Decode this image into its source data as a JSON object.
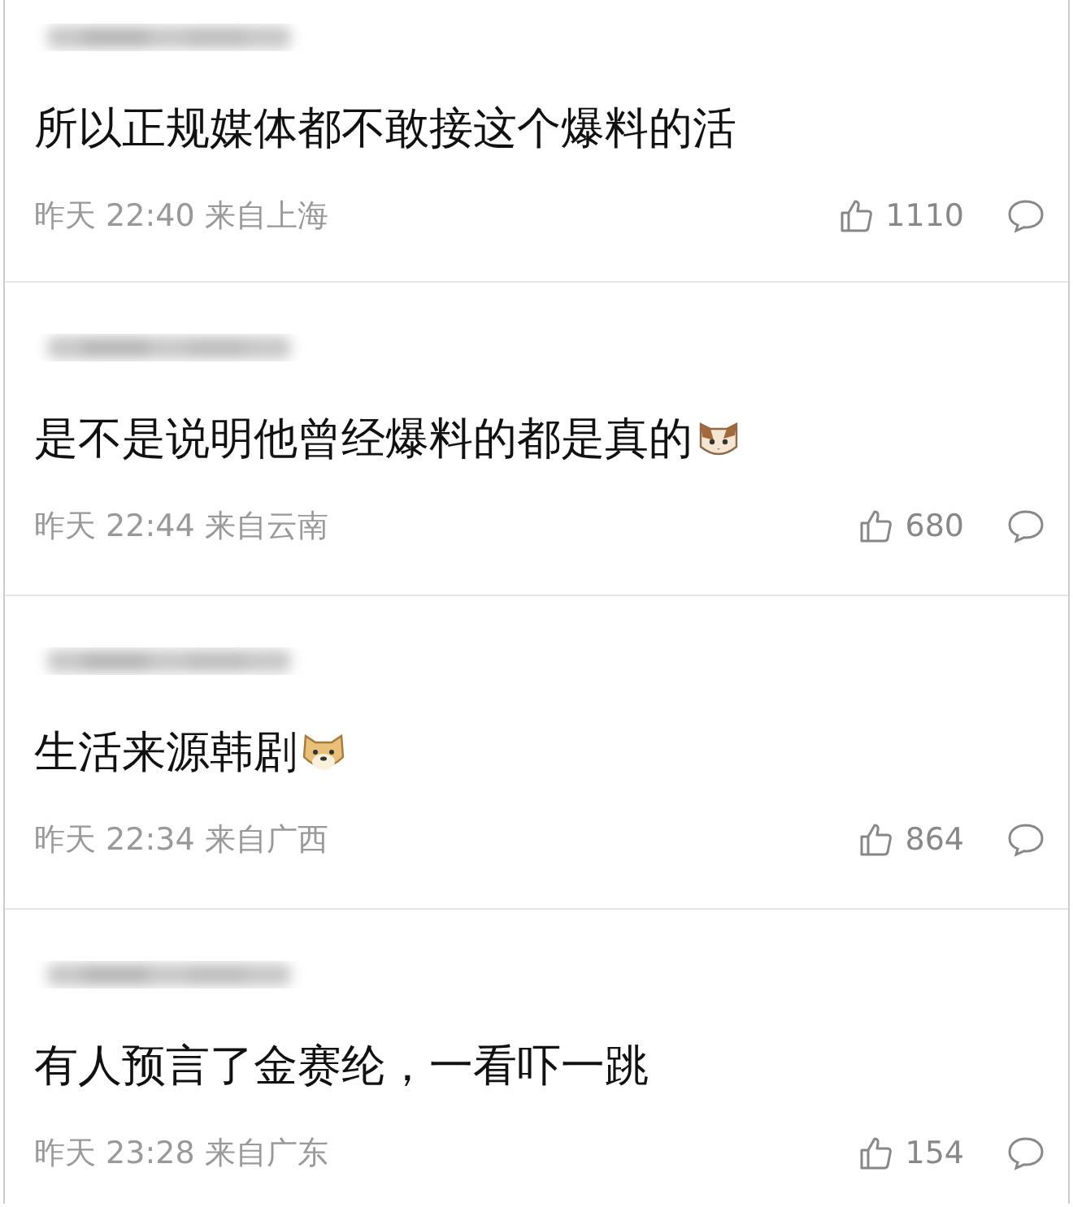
{
  "comments": [
    {
      "kind": "plain",
      "text": "所以正规媒体都不敢接这个爆料的活",
      "meta": "昨天 22:40 来自上海",
      "likes": "1110"
    },
    {
      "kind": "cat",
      "text": "是不是说明他曾经爆料的都是真的",
      "meta": "昨天 22:44 来自云南",
      "likes": "680"
    },
    {
      "kind": "doge",
      "text": "生活来源韩剧",
      "meta": "昨天 22:34 来自广西",
      "likes": "864"
    },
    {
      "kind": "plain",
      "text": "有人预言了金赛纶，一看吓一跳",
      "meta": "昨天 23:28 来自广东",
      "likes": "154"
    }
  ]
}
